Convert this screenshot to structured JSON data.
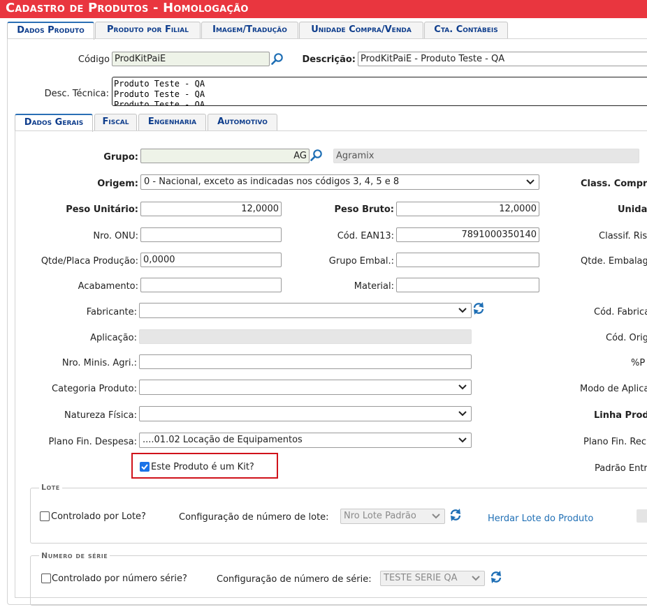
{
  "window": {
    "title": "Cadastro de Produtos - Homologação"
  },
  "top_tabs": [
    "Dados Produto",
    "Produto por Filial",
    "Imagem/Tradução",
    "Unidade Compra/Venda",
    "Cta. Contábeis"
  ],
  "header": {
    "codigo_label": "Código",
    "codigo_value": "ProdKitPaiE",
    "descricao_label": "Descrição:",
    "descricao_value": "ProdKitPaiE - Produto Teste - QA",
    "desc_tecnica_label": "Desc. Técnica:",
    "desc_tecnica_value": "Produto Teste - QA\nProduto Teste - QA\nProduto Teste - QA"
  },
  "sub_tabs": [
    "Dados Gerais",
    "Fiscal",
    "Engenharia",
    "Automotivo"
  ],
  "form": {
    "grupo_label": "Grupo:",
    "grupo_value": "AG",
    "grupo_desc": "Agramix",
    "origem_label": "Origem:",
    "origem_value": "0 - Nacional, exceto as indicadas nos códigos 3, 4, 5 e 8",
    "peso_unitario_label": "Peso Unitário:",
    "peso_unitario_value": "12,0000",
    "peso_bruto_label": "Peso Bruto:",
    "peso_bruto_value": "12,0000",
    "nro_onu_label": "Nro. ONU:",
    "cod_ean13_label": "Cód. EAN13:",
    "cod_ean13_value": "7891000350140",
    "qtde_placa_label": "Qtde/Placa Produção:",
    "qtde_placa_value": "0,0000",
    "grupo_embal_label": "Grupo Embal.:",
    "acabamento_label": "Acabamento:",
    "material_label": "Material:",
    "fabricante_label": "Fabricante:",
    "aplicacao_label": "Aplicação:",
    "nro_minis_label": "Nro. Minis. Agri.:",
    "categoria_label": "Categoria Produto:",
    "natureza_label": "Natureza Física:",
    "plano_fin_label": "Plano Fin. Despesa:",
    "plano_fin_value": "....01.02 Locação de Equipamentos",
    "kit_label": "Este Produto é um Kit?",
    "kit_checked": true
  },
  "right_column": {
    "class_compra": "Class. Compr",
    "unidade": "Unida",
    "classif_risco": "Classif. Ris",
    "qtde_embalagem": "Qtde. Embalag",
    "cod_fabricante": "Cód. Fabrica",
    "cod_origem": "Cód. Orig",
    "pct": "%P",
    "modo_aplicacao": "Modo de Aplica",
    "linha_produto": "Linha Prod",
    "plano_fin_receita": "Plano Fin. Rec",
    "padrao_entrada": "Padrão Entr"
  },
  "lote": {
    "legend": "Lote",
    "controlado_label": "Controlado por Lote?",
    "config_label": "Configuração de número de lote:",
    "config_value": "Nro Lote Padrão",
    "herdar_link": "Herdar Lote do Produto"
  },
  "serie": {
    "legend": "Numero de série",
    "controlado_label": "Controlado por número série?",
    "config_label": "Configuração de número de série:",
    "config_value": "TESTE SERIE QA"
  },
  "colors": {
    "title_bar": "#e9363f",
    "tab_text": "#0e3d8c",
    "link": "#1f6fb5",
    "highlight": "#d0121b"
  },
  "icons": {
    "search": "search-icon",
    "refresh": "refresh-icon",
    "chevron": "chevron-down-icon"
  }
}
